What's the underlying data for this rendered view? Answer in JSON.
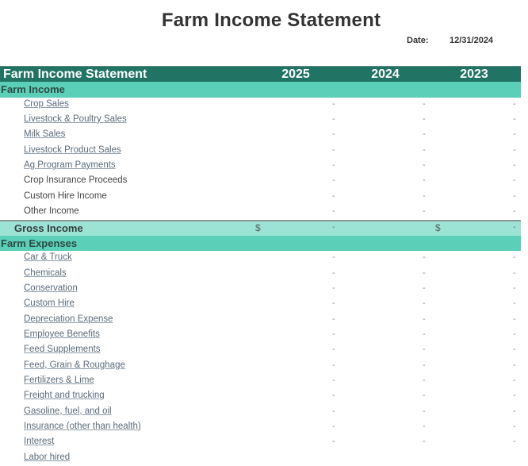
{
  "document": {
    "title": "Farm Income Statement",
    "date_label": "Date:",
    "date_value": "12/31/2024"
  },
  "table": {
    "header": {
      "label": "Farm Income Statement",
      "years": [
        "2025",
        "2024",
        "2023"
      ]
    },
    "income_section": {
      "label": "Farm Income",
      "items": [
        {
          "label": "Crop Sales",
          "link": true,
          "values": [
            "-",
            "-",
            "-"
          ]
        },
        {
          "label": "Livestock & Poultry Sales",
          "link": true,
          "values": [
            "-",
            "-",
            "-"
          ]
        },
        {
          "label": "Milk Sales",
          "link": true,
          "values": [
            "-",
            "-",
            "-"
          ]
        },
        {
          "label": "Livestock Product Sales",
          "link": true,
          "values": [
            "-",
            "-",
            "-"
          ]
        },
        {
          "label": "Ag Program Payments",
          "link": true,
          "values": [
            "-",
            "-",
            "-"
          ]
        },
        {
          "label": "Crop Insurance Proceeds",
          "link": false,
          "values": [
            "-",
            "-",
            "-"
          ]
        },
        {
          "label": "Custom Hire Income",
          "link": false,
          "values": [
            "-",
            "-",
            "-"
          ]
        },
        {
          "label": "Other Income",
          "link": false,
          "values": [
            "-",
            "-",
            "-"
          ]
        }
      ]
    },
    "gross_income": {
      "label": "Gross Income",
      "currency_symbol": "$",
      "value_2025": "-",
      "value_2023": "-"
    },
    "expense_section": {
      "label": "Farm Expenses",
      "items": [
        {
          "label": "Car & Truck",
          "link": true,
          "values": [
            "-",
            "-",
            "-"
          ]
        },
        {
          "label": "Chemicals",
          "link": true,
          "values": [
            "-",
            "-",
            "-"
          ]
        },
        {
          "label": "Conservation",
          "link": true,
          "values": [
            "-",
            "-",
            "-"
          ]
        },
        {
          "label": "Custom Hire",
          "link": true,
          "values": [
            "-",
            "-",
            "-"
          ]
        },
        {
          "label": "Depreciation Expense",
          "link": true,
          "values": [
            "-",
            "-",
            "-"
          ]
        },
        {
          "label": "Employee Benefits",
          "link": true,
          "values": [
            "-",
            "-",
            "-"
          ]
        },
        {
          "label": "Feed Supplements",
          "link": true,
          "values": [
            "-",
            "-",
            "-"
          ]
        },
        {
          "label": "Feed, Grain & Roughage",
          "link": true,
          "values": [
            "-",
            "-",
            "-"
          ]
        },
        {
          "label": "Fertilizers & Lime",
          "link": true,
          "values": [
            "-",
            "-",
            "-"
          ]
        },
        {
          "label": "Freight and trucking",
          "link": true,
          "values": [
            "-",
            "-",
            "-"
          ]
        },
        {
          "label": "Gasoline, fuel, and oil",
          "link": true,
          "values": [
            "-",
            "-",
            "-"
          ]
        },
        {
          "label": "Insurance (other than health)",
          "link": true,
          "values": [
            "-",
            "-",
            "-"
          ]
        },
        {
          "label": "Interest",
          "link": true,
          "values": [
            "-",
            "-",
            "-"
          ]
        },
        {
          "label": "Labor hired",
          "link": true,
          "values": [
            "",
            "",
            ""
          ]
        }
      ]
    }
  }
}
